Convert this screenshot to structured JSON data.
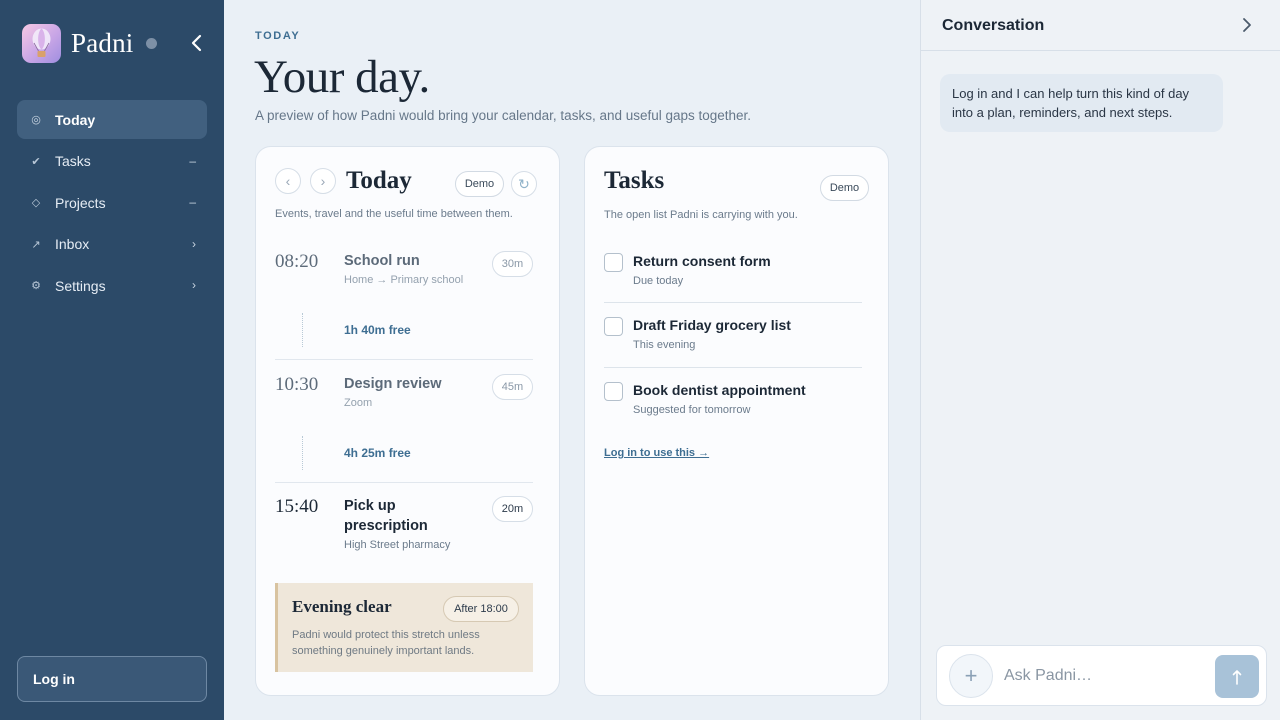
{
  "sidebar": {
    "brand": "Padni",
    "items": [
      {
        "label": "Today",
        "icon": "◎",
        "trail": ""
      },
      {
        "label": "Tasks",
        "icon": "✔",
        "trail": "–"
      },
      {
        "label": "Projects",
        "icon": "◇",
        "trail": "–"
      },
      {
        "label": "Inbox",
        "icon": "↗",
        "trail": "›"
      },
      {
        "label": "Settings",
        "icon": "⚙",
        "trail": "›"
      }
    ],
    "login_label": "Log in"
  },
  "main": {
    "eyebrow": "TODAY",
    "title": "Your day.",
    "subtitle": "A preview of how Padni would bring your calendar, tasks, and useful gaps together."
  },
  "today_card": {
    "title": "Today",
    "badge": "Demo",
    "description": "Events, travel and the useful time between them.",
    "events": [
      {
        "time": "08:20",
        "title": "School run",
        "sub": "Home → Primary school",
        "duration": "30m"
      },
      {
        "time": "10:30",
        "title": "Design review",
        "sub": "Zoom",
        "duration": "45m"
      },
      {
        "time": "15:40",
        "title": "Pick up prescription",
        "sub": "High Street pharmacy",
        "duration": "20m"
      }
    ],
    "gaps": [
      "1h 40m free",
      "4h 25m free"
    ],
    "evening": {
      "title": "Evening clear",
      "badge": "After 18:00",
      "text": "Padni would protect this stretch unless something genuinely important lands."
    }
  },
  "tasks_card": {
    "title": "Tasks",
    "badge": "Demo",
    "description": "The open list Padni is carrying with you.",
    "tasks": [
      {
        "title": "Return consent form",
        "sub": "Due today"
      },
      {
        "title": "Draft Friday grocery list",
        "sub": "This evening"
      },
      {
        "title": "Book dentist appointment",
        "sub": "Suggested for tomorrow"
      }
    ],
    "link": "Log in to use this →"
  },
  "conversation": {
    "title": "Conversation",
    "message": "Log in and I can help turn this kind of day into a plan, reminders, and next steps.",
    "input_placeholder": "Ask Padni…"
  },
  "colors": {
    "sidebar_bg": "#2c4a68",
    "accent": "#3e6e92",
    "page_bg": "#eaf0f6"
  }
}
